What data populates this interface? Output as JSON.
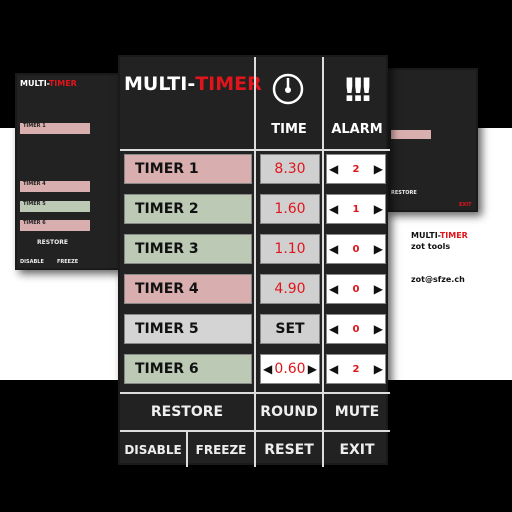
{
  "app": {
    "title_a": "MULTI-",
    "title_b": "TIMER"
  },
  "columns": {
    "time": "TIME",
    "alarm": "ALARM",
    "time_icon": "stopwatch-icon",
    "alarm_icon": "exclamation-icon"
  },
  "timers": [
    {
      "name": "TIMER 1",
      "time": "8.30",
      "alarm": "2",
      "color": "#d9aeae"
    },
    {
      "name": "TIMER 2",
      "time": "1.60",
      "alarm": "1",
      "color": "#bccab5"
    },
    {
      "name": "TIMER 3",
      "time": "1.10",
      "alarm": "0",
      "color": "#bccab5"
    },
    {
      "name": "TIMER 4",
      "time": "4.90",
      "alarm": "0",
      "color": "#d9aeae"
    },
    {
      "name": "TIMER 5",
      "time": "SET",
      "alarm": "0",
      "color": "#d4d4d4"
    },
    {
      "name": "TIMER 6",
      "time": "0.60",
      "alarm": "2",
      "color": "#bccab5"
    }
  ],
  "buttons": {
    "restore": "RESTORE",
    "round": "ROUND",
    "mute": "MUTE",
    "disable": "DISABLE",
    "freeze": "FREEZE",
    "reset": "RESET",
    "exit": "EXIT"
  },
  "colors": {
    "accent": "#e0151b",
    "panel": "#222222"
  },
  "info": {
    "app_a": "MULTI-",
    "app_b": "TIMER",
    "company": "zot tools",
    "email": "zot@sfze.ch"
  }
}
